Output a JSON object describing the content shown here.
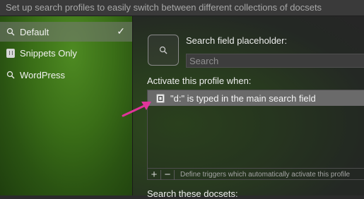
{
  "header": {
    "description": "Set up search profiles to easily switch between different collections of docsets"
  },
  "profiles": [
    {
      "label": "Default",
      "icon": "magnifier-icon",
      "selected": true
    },
    {
      "label": "Snippets Only",
      "icon": "snippet-icon",
      "selected": false
    },
    {
      "label": "WordPress",
      "icon": "magnifier-icon",
      "selected": false
    }
  ],
  "selected_check": "✓",
  "editor": {
    "placeholder_label": "Search field placeholder:",
    "placeholder_value": "Search",
    "activate_label": "Activate this profile when:",
    "triggers": [
      {
        "text": "\"d:\" is typed in the main search field",
        "icon": "keyword-trigger-icon"
      }
    ],
    "add_label": "+",
    "remove_label": "−",
    "toolbar_hint": "Define triggers which automatically activate this profile",
    "docsets_label": "Search these docsets:"
  },
  "colors": {
    "annotation_arrow": "#e0349a",
    "selection": "#6a6a6a"
  }
}
